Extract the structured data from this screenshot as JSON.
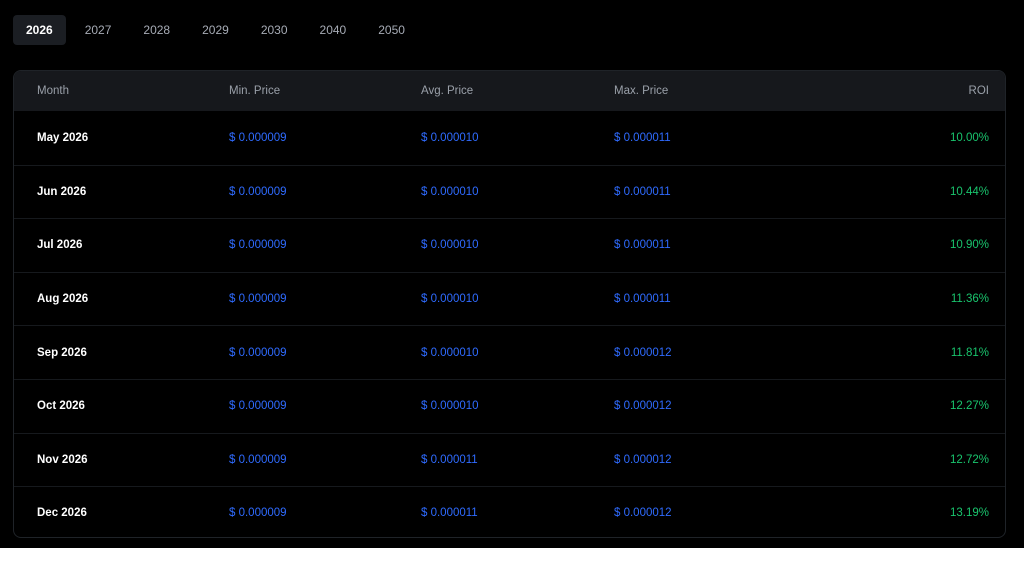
{
  "tabs": [
    {
      "label": "2026",
      "active": true
    },
    {
      "label": "2027",
      "active": false
    },
    {
      "label": "2028",
      "active": false
    },
    {
      "label": "2029",
      "active": false
    },
    {
      "label": "2030",
      "active": false
    },
    {
      "label": "2040",
      "active": false
    },
    {
      "label": "2050",
      "active": false
    }
  ],
  "table": {
    "headers": {
      "month": "Month",
      "min": "Min. Price",
      "avg": "Avg. Price",
      "max": "Max. Price",
      "roi": "ROI"
    },
    "rows": [
      {
        "month": "May 2026",
        "min": "$ 0.000009",
        "avg": "$ 0.000010",
        "max": "$ 0.000011",
        "roi": "10.00%"
      },
      {
        "month": "Jun 2026",
        "min": "$ 0.000009",
        "avg": "$ 0.000010",
        "max": "$ 0.000011",
        "roi": "10.44%"
      },
      {
        "month": "Jul 2026",
        "min": "$ 0.000009",
        "avg": "$ 0.000010",
        "max": "$ 0.000011",
        "roi": "10.90%"
      },
      {
        "month": "Aug 2026",
        "min": "$ 0.000009",
        "avg": "$ 0.000010",
        "max": "$ 0.000011",
        "roi": "11.36%"
      },
      {
        "month": "Sep 2026",
        "min": "$ 0.000009",
        "avg": "$ 0.000010",
        "max": "$ 0.000012",
        "roi": "11.81%"
      },
      {
        "month": "Oct 2026",
        "min": "$ 0.000009",
        "avg": "$ 0.000010",
        "max": "$ 0.000012",
        "roi": "12.27%"
      },
      {
        "month": "Nov 2026",
        "min": "$ 0.000009",
        "avg": "$ 0.000011",
        "max": "$ 0.000012",
        "roi": "12.72%"
      },
      {
        "month": "Dec 2026",
        "min": "$ 0.000009",
        "avg": "$ 0.000011",
        "max": "$ 0.000012",
        "roi": "13.19%"
      }
    ]
  },
  "colors": {
    "background": "#000000",
    "price_text": "#2f6bff",
    "roi_text": "#19c46d",
    "header_bg": "#16181c"
  }
}
